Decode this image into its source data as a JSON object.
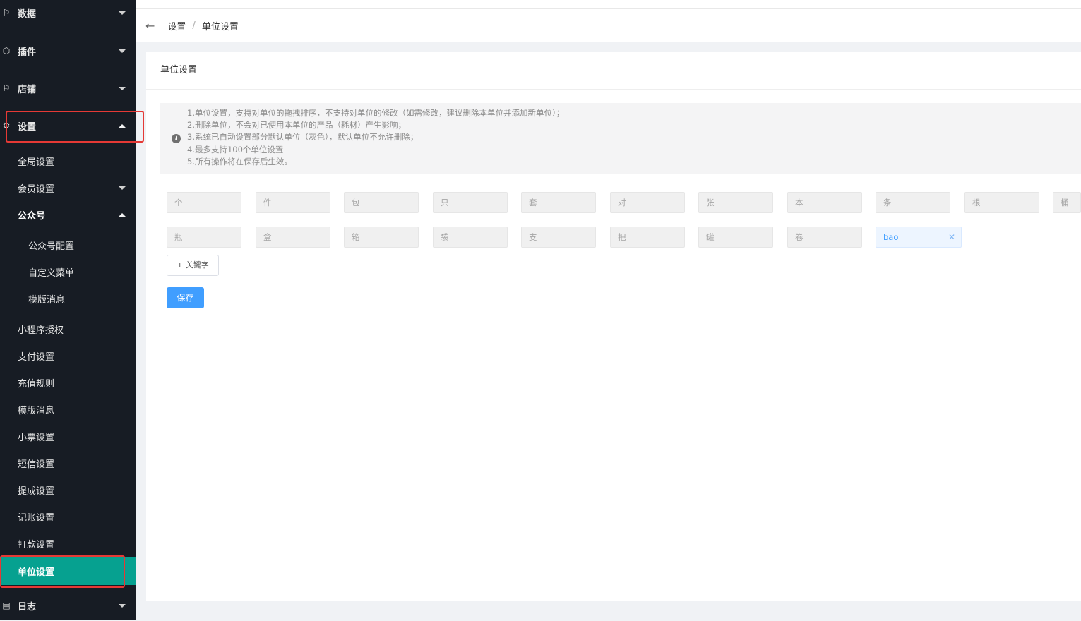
{
  "sidebar": {
    "data": "数据",
    "plugins": "插件",
    "store": "店铺",
    "settings": "设置",
    "global": "全局设置",
    "member": "会员设置",
    "official_account": "公众号",
    "oa_config": "公众号配置",
    "custom_menu": "自定义菜单",
    "oa_template": "模版消息",
    "miniapp_auth": "小程序授权",
    "payment": "支付设置",
    "recharge": "充值规则",
    "template": "模版消息",
    "receipt": "小票设置",
    "sms": "短信设置",
    "commission": "提成设置",
    "bookkeeping": "记账设置",
    "payout": "打款设置",
    "unit": "单位设置",
    "log": "日志"
  },
  "breadcrumb": {
    "parent": "设置",
    "separator": "/",
    "current": "单位设置"
  },
  "card": {
    "title": "单位设置"
  },
  "notice": {
    "line1": "1.单位设置，支持对单位的拖拽排序，不支持对单位的修改（如需修改，建议删除本单位并添加新单位）；",
    "line2": "2.删除单位，不会对已使用本单位的产品（耗材）产生影响；",
    "line3": "3.系统已自动设置部分默认单位（灰色），默认单位不允许删除；",
    "line4": "4.最多支持100个单位设置",
    "line5": "5.所有操作将在保存后生效。"
  },
  "units_row1": [
    "个",
    "件",
    "包",
    "只",
    "套",
    "对",
    "张",
    "本",
    "条",
    "根",
    "桶"
  ],
  "units_row2": [
    "瓶",
    "盒",
    "箱",
    "袋",
    "支",
    "把",
    "罐",
    "卷"
  ],
  "custom_unit": "bao",
  "add_keyword_label": "+ 关键字",
  "save_label": "保存"
}
